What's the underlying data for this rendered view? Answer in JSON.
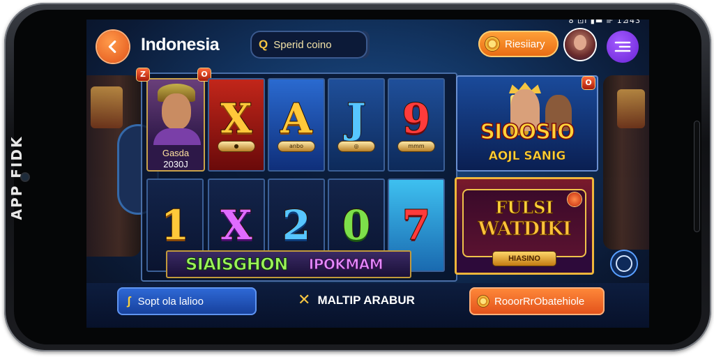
{
  "device": {
    "side_text": "APP FIDK"
  },
  "status_bar": {
    "text": "8 ⊡l ▮▬ ⊪ 1⊿43"
  },
  "header": {
    "title": "Indonesia",
    "search": {
      "icon": "search-icon",
      "placeholder": "Sperid coino"
    },
    "balance_button": {
      "label": "Riesiiary",
      "icon": "coin-icon"
    },
    "avatar": "avatar",
    "menu_icon": "menu-icon"
  },
  "reels": {
    "portrait": {
      "name": "Gasda",
      "value": "2030J",
      "badge_top_left": "Z",
      "badge_top_right": "O"
    },
    "row1": [
      {
        "symbol": "X",
        "color": "gold",
        "tag": "●"
      },
      {
        "symbol": "A",
        "color": "gold",
        "tag": "anbo"
      },
      {
        "symbol": "J",
        "color": "blue",
        "tag": "◎"
      },
      {
        "symbol": "9",
        "color": "red",
        "tag": "mmm"
      }
    ],
    "row2": [
      {
        "symbol": "1",
        "color": "gold"
      },
      {
        "symbol": "X",
        "color": "purple"
      },
      {
        "symbol": "2",
        "color": "blue"
      },
      {
        "symbol": "0",
        "color": "green"
      },
      {
        "symbol": "7",
        "color": "red"
      }
    ],
    "strip_left": "SIAISGHON",
    "strip_right": "IPOKMAM"
  },
  "promos": {
    "top": {
      "title": "SIOOSIO",
      "subtitle": "AOJL SANIG",
      "badge": "O"
    },
    "bottom": {
      "line1": "FULSI",
      "line2": "WATDIKI",
      "pill": "HIASINO"
    }
  },
  "bottom_bar": {
    "left_button": "Sopt ola lalioo",
    "left_icon": "lightning-icon",
    "center_label": "MALTIP ARABUR",
    "center_icon": "cross-swords-icon",
    "right_button": "RooorRrObatehiole",
    "right_icon": "coin-icon"
  },
  "colors": {
    "accent_orange": "#ff8a3a",
    "accent_purple": "#7a30e0",
    "primary_blue": "#2f6ad8",
    "gold": "#ffc83a"
  }
}
